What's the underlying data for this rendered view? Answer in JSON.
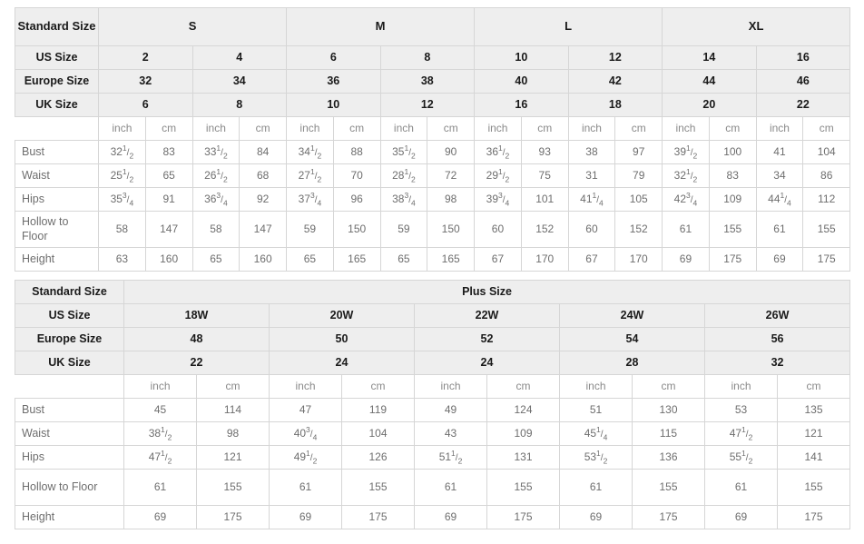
{
  "colors": {
    "header_bg": "#eeeeee",
    "cell_bg": "#ffffff",
    "border": "#d6d6d6",
    "header_text": "#1a1a1a",
    "cell_text": "#6e6e6e"
  },
  "standard_table": {
    "row_labels": {
      "standard_size": "Standard Size",
      "us_size": "US Size",
      "europe_size": "Europe Size",
      "uk_size": "UK Size",
      "bust": "Bust",
      "waist": "Waist",
      "hips": "Hips",
      "hollow_to_floor": "Hollow to Floor",
      "height": "Height"
    },
    "size_groups": [
      {
        "label": "S",
        "columns": 2
      },
      {
        "label": "M",
        "columns": 2
      },
      {
        "label": "L",
        "columns": 2
      },
      {
        "label": "XL",
        "columns": 2
      }
    ],
    "us_sizes": [
      "2",
      "4",
      "6",
      "8",
      "10",
      "12",
      "14",
      "16"
    ],
    "europe_sizes": [
      "32",
      "34",
      "36",
      "38",
      "40",
      "42",
      "44",
      "46"
    ],
    "uk_sizes": [
      "6",
      "8",
      "10",
      "12",
      "16",
      "18",
      "20",
      "22"
    ],
    "units": [
      "inch",
      "cm",
      "inch",
      "cm",
      "inch",
      "cm",
      "inch",
      "cm",
      "inch",
      "cm",
      "inch",
      "cm",
      "inch",
      "cm",
      "inch",
      "cm"
    ],
    "measurements": [
      {
        "label": "Bust",
        "values": [
          {
            "whole": "32",
            "num": "1",
            "den": "2"
          },
          {
            "whole": "83"
          },
          {
            "whole": "33",
            "num": "1",
            "den": "2"
          },
          {
            "whole": "84"
          },
          {
            "whole": "34",
            "num": "1",
            "den": "2"
          },
          {
            "whole": "88"
          },
          {
            "whole": "35",
            "num": "1",
            "den": "2"
          },
          {
            "whole": "90"
          },
          {
            "whole": "36",
            "num": "1",
            "den": "2"
          },
          {
            "whole": "93"
          },
          {
            "whole": "38"
          },
          {
            "whole": "97"
          },
          {
            "whole": "39",
            "num": "1",
            "den": "2"
          },
          {
            "whole": "100"
          },
          {
            "whole": "41"
          },
          {
            "whole": "104"
          }
        ]
      },
      {
        "label": "Waist",
        "values": [
          {
            "whole": "25",
            "num": "1",
            "den": "2"
          },
          {
            "whole": "65"
          },
          {
            "whole": "26",
            "num": "1",
            "den": "2"
          },
          {
            "whole": "68"
          },
          {
            "whole": "27",
            "num": "1",
            "den": "2"
          },
          {
            "whole": "70"
          },
          {
            "whole": "28",
            "num": "1",
            "den": "2"
          },
          {
            "whole": "72"
          },
          {
            "whole": "29",
            "num": "1",
            "den": "2"
          },
          {
            "whole": "75"
          },
          {
            "whole": "31"
          },
          {
            "whole": "79"
          },
          {
            "whole": "32",
            "num": "1",
            "den": "2"
          },
          {
            "whole": "83"
          },
          {
            "whole": "34"
          },
          {
            "whole": "86"
          }
        ]
      },
      {
        "label": "Hips",
        "values": [
          {
            "whole": "35",
            "num": "3",
            "den": "4"
          },
          {
            "whole": "91"
          },
          {
            "whole": "36",
            "num": "3",
            "den": "4"
          },
          {
            "whole": "92"
          },
          {
            "whole": "37",
            "num": "3",
            "den": "4"
          },
          {
            "whole": "96"
          },
          {
            "whole": "38",
            "num": "3",
            "den": "4"
          },
          {
            "whole": "98"
          },
          {
            "whole": "39",
            "num": "3",
            "den": "4"
          },
          {
            "whole": "101"
          },
          {
            "whole": "41",
            "num": "1",
            "den": "4"
          },
          {
            "whole": "105"
          },
          {
            "whole": "42",
            "num": "3",
            "den": "4"
          },
          {
            "whole": "109"
          },
          {
            "whole": "44",
            "num": "1",
            "den": "4"
          },
          {
            "whole": "112"
          }
        ]
      },
      {
        "label": "Hollow to Floor",
        "label_line1": "Hollow to",
        "label_line2": "Floor",
        "values": [
          {
            "whole": "58"
          },
          {
            "whole": "147"
          },
          {
            "whole": "58"
          },
          {
            "whole": "147"
          },
          {
            "whole": "59"
          },
          {
            "whole": "150"
          },
          {
            "whole": "59"
          },
          {
            "whole": "150"
          },
          {
            "whole": "60"
          },
          {
            "whole": "152"
          },
          {
            "whole": "60"
          },
          {
            "whole": "152"
          },
          {
            "whole": "61"
          },
          {
            "whole": "155"
          },
          {
            "whole": "61"
          },
          {
            "whole": "155"
          }
        ]
      },
      {
        "label": "Height",
        "values": [
          {
            "whole": "63"
          },
          {
            "whole": "160"
          },
          {
            "whole": "65"
          },
          {
            "whole": "160"
          },
          {
            "whole": "65"
          },
          {
            "whole": "165"
          },
          {
            "whole": "65"
          },
          {
            "whole": "165"
          },
          {
            "whole": "67"
          },
          {
            "whole": "170"
          },
          {
            "whole": "67"
          },
          {
            "whole": "170"
          },
          {
            "whole": "69"
          },
          {
            "whole": "175"
          },
          {
            "whole": "69"
          },
          {
            "whole": "175"
          }
        ]
      }
    ]
  },
  "plus_table": {
    "row_labels": {
      "standard_size": "Standard Size",
      "us_size": "US Size",
      "europe_size": "Europe Size",
      "uk_size": "UK Size"
    },
    "group_label": "Plus Size",
    "us_sizes": [
      "18W",
      "20W",
      "22W",
      "24W",
      "26W"
    ],
    "europe_sizes": [
      "48",
      "50",
      "52",
      "54",
      "56"
    ],
    "uk_sizes": [
      "22",
      "24",
      "24",
      "28",
      "32"
    ],
    "units": [
      "inch",
      "cm",
      "inch",
      "cm",
      "inch",
      "cm",
      "inch",
      "cm",
      "inch",
      "cm"
    ],
    "measurements": [
      {
        "label": "Bust",
        "values": [
          {
            "whole": "45"
          },
          {
            "whole": "114"
          },
          {
            "whole": "47"
          },
          {
            "whole": "119"
          },
          {
            "whole": "49"
          },
          {
            "whole": "124"
          },
          {
            "whole": "51"
          },
          {
            "whole": "130"
          },
          {
            "whole": "53"
          },
          {
            "whole": "135"
          }
        ]
      },
      {
        "label": "Waist",
        "values": [
          {
            "whole": "38",
            "num": "1",
            "den": "2"
          },
          {
            "whole": "98"
          },
          {
            "whole": "40",
            "num": "3",
            "den": "4"
          },
          {
            "whole": "104"
          },
          {
            "whole": "43"
          },
          {
            "whole": "109"
          },
          {
            "whole": "45",
            "num": "1",
            "den": "4"
          },
          {
            "whole": "115"
          },
          {
            "whole": "47",
            "num": "1",
            "den": "2"
          },
          {
            "whole": "121"
          }
        ]
      },
      {
        "label": "Hips",
        "values": [
          {
            "whole": "47",
            "num": "1",
            "den": "2"
          },
          {
            "whole": "121"
          },
          {
            "whole": "49",
            "num": "1",
            "den": "2"
          },
          {
            "whole": "126"
          },
          {
            "whole": "51",
            "num": "1",
            "den": "2"
          },
          {
            "whole": "131"
          },
          {
            "whole": "53",
            "num": "1",
            "den": "2"
          },
          {
            "whole": "136"
          },
          {
            "whole": "55",
            "num": "1",
            "den": "2"
          },
          {
            "whole": "141"
          }
        ]
      },
      {
        "label": "Hollow to Floor",
        "values": [
          {
            "whole": "61"
          },
          {
            "whole": "155"
          },
          {
            "whole": "61"
          },
          {
            "whole": "155"
          },
          {
            "whole": "61"
          },
          {
            "whole": "155"
          },
          {
            "whole": "61"
          },
          {
            "whole": "155"
          },
          {
            "whole": "61"
          },
          {
            "whole": "155"
          }
        ]
      },
      {
        "label": "Height",
        "values": [
          {
            "whole": "69"
          },
          {
            "whole": "175"
          },
          {
            "whole": "69"
          },
          {
            "whole": "175"
          },
          {
            "whole": "69"
          },
          {
            "whole": "175"
          },
          {
            "whole": "69"
          },
          {
            "whole": "175"
          },
          {
            "whole": "69"
          },
          {
            "whole": "175"
          }
        ]
      }
    ]
  }
}
